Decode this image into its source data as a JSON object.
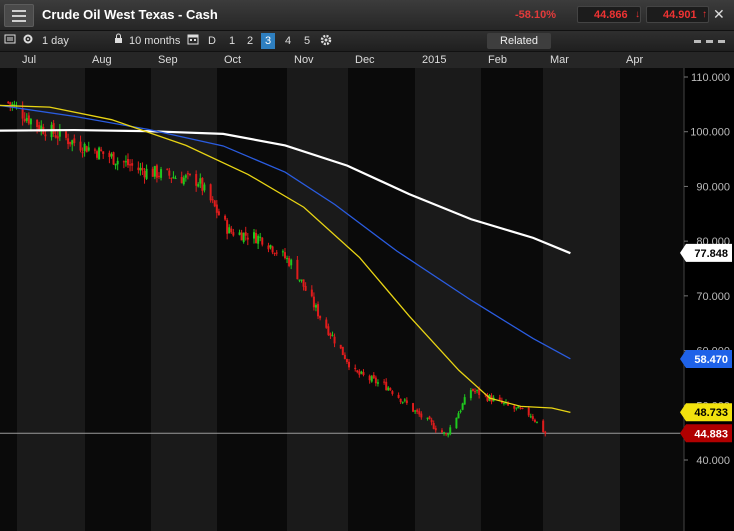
{
  "header": {
    "title": "Crude Oil West Texas - Cash",
    "change": "-58.10%",
    "bid": "44.866",
    "ask": "44.901",
    "close_symbol": "✕"
  },
  "toolbar": {
    "interval": "1 day",
    "range": "10 months",
    "draw_label": "D",
    "chart_numbers": [
      "1",
      "2",
      "3",
      "4",
      "5"
    ],
    "selected_chart": "3",
    "related_label": "Related"
  },
  "colors": {
    "up": "#1ec81e",
    "down": "#e01c1c",
    "ma_fast": "#e8d414",
    "ma_mid": "#2a5ce0",
    "ma_slow": "#ffffff",
    "panel_light": "#1a1a1a",
    "panel_dark": "#0a0a0a",
    "last_price_bg": "#b00000"
  },
  "chart_data": {
    "type": "line",
    "months": [
      "Jul",
      "Aug",
      "Sep",
      "Oct",
      "Nov",
      "Dec",
      "2015",
      "Feb",
      "Mar",
      "Apr"
    ],
    "y_ticks": [
      "110.000",
      "100.000",
      "90.000",
      "80.000",
      "70.000",
      "60.000",
      "50.000",
      "40.000"
    ],
    "ylim": [
      34,
      111
    ],
    "price_ohlc_approx": [
      [
        "2014-06-30",
        105.4
      ],
      [
        "2014-07-15",
        101.0
      ],
      [
        "2014-07-31",
        98.2
      ],
      [
        "2014-08-15",
        96.0
      ],
      [
        "2014-09-02",
        93.0
      ],
      [
        "2014-09-30",
        91.0
      ],
      [
        "2014-10-15",
        81.8
      ],
      [
        "2014-10-31",
        80.5
      ],
      [
        "2014-11-14",
        76.0
      ],
      [
        "2014-11-28",
        66.2
      ],
      [
        "2014-12-15",
        55.9
      ],
      [
        "2014-12-31",
        53.3
      ],
      [
        "2015-01-14",
        48.5
      ],
      [
        "2015-01-28",
        44.5
      ],
      [
        "2015-02-09",
        52.9
      ],
      [
        "2015-02-27",
        49.8
      ],
      [
        "2015-03-10",
        48.3
      ],
      [
        "2015-03-17",
        44.9
      ]
    ],
    "series": [
      {
        "name": "",
        "color_key": "ma_slow",
        "last": 77.848,
        "last_label": "77.848",
        "points": [
          [
            0,
            100.2
          ],
          [
            60,
            100.3
          ],
          [
            120,
            100.1
          ],
          [
            180,
            99.6
          ],
          [
            230,
            97.5
          ],
          [
            280,
            93.8
          ],
          [
            330,
            88.6
          ],
          [
            380,
            84.0
          ],
          [
            430,
            80.6
          ],
          [
            460,
            77.8
          ]
        ]
      },
      {
        "name": "",
        "color_key": "ma_mid",
        "last": 58.47,
        "last_label": "58.470",
        "points": [
          [
            0,
            104.8
          ],
          [
            60,
            102.8
          ],
          [
            120,
            100.4
          ],
          [
            180,
            97.4
          ],
          [
            230,
            92.6
          ],
          [
            270,
            86.7
          ],
          [
            320,
            78.2
          ],
          [
            380,
            69.2
          ],
          [
            430,
            62.2
          ],
          [
            460,
            58.5
          ]
        ]
      },
      {
        "name": "",
        "color_key": "ma_fast",
        "last": 48.733,
        "last_label": "48.733",
        "points": [
          [
            0,
            104.8
          ],
          [
            40,
            104.5
          ],
          [
            90,
            102.2
          ],
          [
            150,
            97.5
          ],
          [
            200,
            92.2
          ],
          [
            245,
            86.2
          ],
          [
            290,
            77.0
          ],
          [
            330,
            66.3
          ],
          [
            370,
            56.4
          ],
          [
            395,
            51.3
          ],
          [
            420,
            49.8
          ],
          [
            445,
            49.5
          ],
          [
            460,
            48.7
          ]
        ]
      }
    ],
    "last_price": 44.883,
    "last_price_label": "44.883"
  }
}
